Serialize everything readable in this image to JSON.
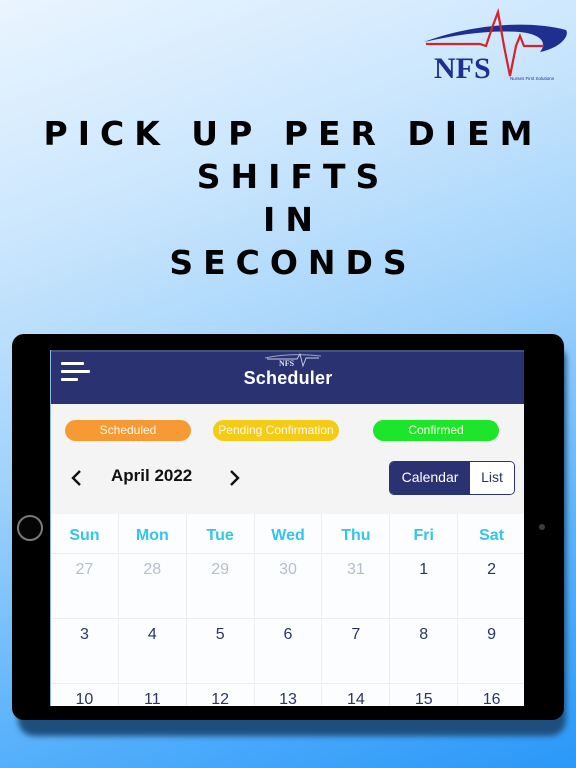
{
  "brand": {
    "logo_text": "NFS",
    "logo_tagline": "Nurses First Solutions",
    "colors": {
      "navy": "#1f2f8f",
      "red": "#d6222b"
    }
  },
  "headline": {
    "lines": [
      "PICK UP PER DIEM",
      "SHIFTS",
      "IN",
      "SECONDS"
    ]
  },
  "app": {
    "header": {
      "menu_icon": "hamburger-menu-icon",
      "logo_text": "NFS",
      "title": "Scheduler",
      "background": "#2b3272"
    },
    "legend": [
      {
        "label": "Scheduled",
        "color": "#f89a33"
      },
      {
        "label": "Pending Confirmation",
        "color": "#f5cc15"
      },
      {
        "label": "Confirmed",
        "color": "#1de52a"
      }
    ],
    "month_nav": {
      "prev_icon": "chevron-left-icon",
      "month_label": "April 2022",
      "next_icon": "chevron-right-icon"
    },
    "view_toggle": {
      "options": [
        "Calendar",
        "List"
      ],
      "selected": "Calendar"
    },
    "calendar": {
      "weekdays": [
        "Sun",
        "Mon",
        "Tue",
        "Wed",
        "Thu",
        "Fri",
        "Sat"
      ],
      "weeks": [
        [
          {
            "day": "27",
            "in_month": false
          },
          {
            "day": "28",
            "in_month": false
          },
          {
            "day": "29",
            "in_month": false
          },
          {
            "day": "30",
            "in_month": false
          },
          {
            "day": "31",
            "in_month": false
          },
          {
            "day": "1",
            "in_month": true
          },
          {
            "day": "2",
            "in_month": true
          }
        ],
        [
          {
            "day": "3",
            "in_month": true
          },
          {
            "day": "4",
            "in_month": true
          },
          {
            "day": "5",
            "in_month": true
          },
          {
            "day": "6",
            "in_month": true
          },
          {
            "day": "7",
            "in_month": true
          },
          {
            "day": "8",
            "in_month": true
          },
          {
            "day": "9",
            "in_month": true
          }
        ],
        [
          {
            "day": "10",
            "in_month": true
          },
          {
            "day": "11",
            "in_month": true
          },
          {
            "day": "12",
            "in_month": true
          },
          {
            "day": "13",
            "in_month": true
          },
          {
            "day": "14",
            "in_month": true
          },
          {
            "day": "15",
            "in_month": true
          },
          {
            "day": "16",
            "in_month": true
          }
        ]
      ]
    }
  }
}
